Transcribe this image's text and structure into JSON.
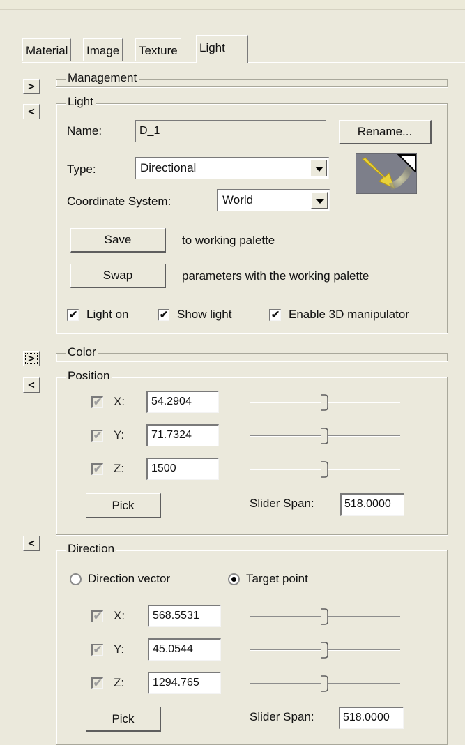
{
  "tabs": [
    {
      "label": "Material"
    },
    {
      "label": "Image"
    },
    {
      "label": "Texture"
    },
    {
      "label": "Light",
      "active": true
    }
  ],
  "side_buttons": {
    "expand": ">",
    "collapse": "<"
  },
  "management": {
    "title": "Management"
  },
  "light": {
    "title": "Light",
    "name_label": "Name:",
    "name_value": "D_1",
    "rename_label": "Rename...",
    "type_label": "Type:",
    "type_value": "Directional",
    "coord_label": "Coordinate System:",
    "coord_value": "World",
    "save_label": "Save",
    "save_desc": "to working palette",
    "swap_label": "Swap",
    "swap_desc": "parameters with the working palette",
    "checks": [
      {
        "label": "Light on",
        "checked": true
      },
      {
        "label": "Show light",
        "checked": true
      },
      {
        "label": "Enable 3D manipulator",
        "checked": true
      }
    ],
    "preview_icon": "directional-light-icon"
  },
  "color": {
    "title": "Color"
  },
  "position": {
    "title": "Position",
    "axes": [
      {
        "label": "X:",
        "value": "54.2904",
        "slider": 0.5
      },
      {
        "label": "Y:",
        "value": "71.7324",
        "slider": 0.5
      },
      {
        "label": "Z:",
        "value": "1500",
        "slider": 0.5
      }
    ],
    "pick_label": "Pick",
    "span_label": "Slider Span:",
    "span_value": "518.0000"
  },
  "direction": {
    "title": "Direction",
    "radio_vector": "Direction vector",
    "radio_target": "Target point",
    "selected": "target",
    "axes": [
      {
        "label": "X:",
        "value": "568.5531",
        "slider": 0.5
      },
      {
        "label": "Y:",
        "value": "45.0544",
        "slider": 0.5
      },
      {
        "label": "Z:",
        "value": "1294.765",
        "slider": 0.5
      }
    ],
    "pick_label": "Pick",
    "span_label": "Slider Span:",
    "span_value": "518.0000"
  },
  "colors": {
    "background": "#ebe9dc",
    "field": "#ffffff"
  }
}
